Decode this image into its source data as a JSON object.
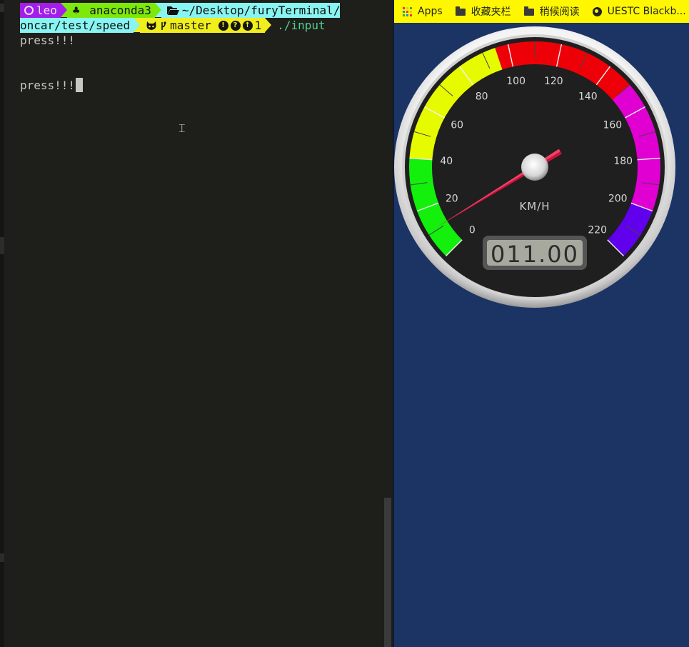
{
  "terminal": {
    "prompt": {
      "user": "leo",
      "env": "anaconda3",
      "path_line1": "~/Desktop/furyTerminal/",
      "path_line2": "oncar/test/speed",
      "branch": "master",
      "status_counts": "1",
      "command": "./input"
    },
    "output_lines": [
      "press!!!",
      "press!!!"
    ],
    "colors": {
      "background": "#1e1f1b",
      "user_segment": "#a31ee8",
      "env_segment": "#7ce80c",
      "path_segment": "#88f5f2",
      "git_segment": "#f1ee1e",
      "command": "#4fce8c",
      "text": "#c8c8c0"
    },
    "icons": [
      "ubuntu-icon",
      "clover-icon",
      "folder-open-icon",
      "github-icon",
      "git-branch-icon",
      "alert-icon",
      "question-icon",
      "arrow-up-icon",
      "text-cursor-icon"
    ]
  },
  "browser": {
    "bookmarks": [
      {
        "label": "Apps",
        "icon": "apps-grid-icon"
      },
      {
        "label": "收藏夹栏",
        "icon": "folder-icon"
      },
      {
        "label": "稍候阅读",
        "icon": "folder-icon"
      },
      {
        "label": "UESTC Blackb...",
        "icon": "globe-icon"
      }
    ],
    "bookmark_bar_color": "#fff700",
    "page_background": "#1b3464"
  },
  "speedometer": {
    "unit": "KM/H",
    "ticks": [
      "0",
      "20",
      "40",
      "60",
      "80",
      "100",
      "120",
      "140",
      "160",
      "180",
      "200",
      "220"
    ],
    "speed": 11,
    "display": "011.00",
    "needle_color": "#d0103a",
    "bands": [
      {
        "from": 0,
        "to": 40,
        "color": "#12f00c"
      },
      {
        "from": 40,
        "to": 95,
        "color": "#e6fa00"
      },
      {
        "from": 95,
        "to": 150,
        "color": "#ee0008"
      },
      {
        "from": 150,
        "to": 200,
        "color": "#e000d2"
      },
      {
        "from": 200,
        "to": 220,
        "color": "#6000ec"
      }
    ]
  }
}
